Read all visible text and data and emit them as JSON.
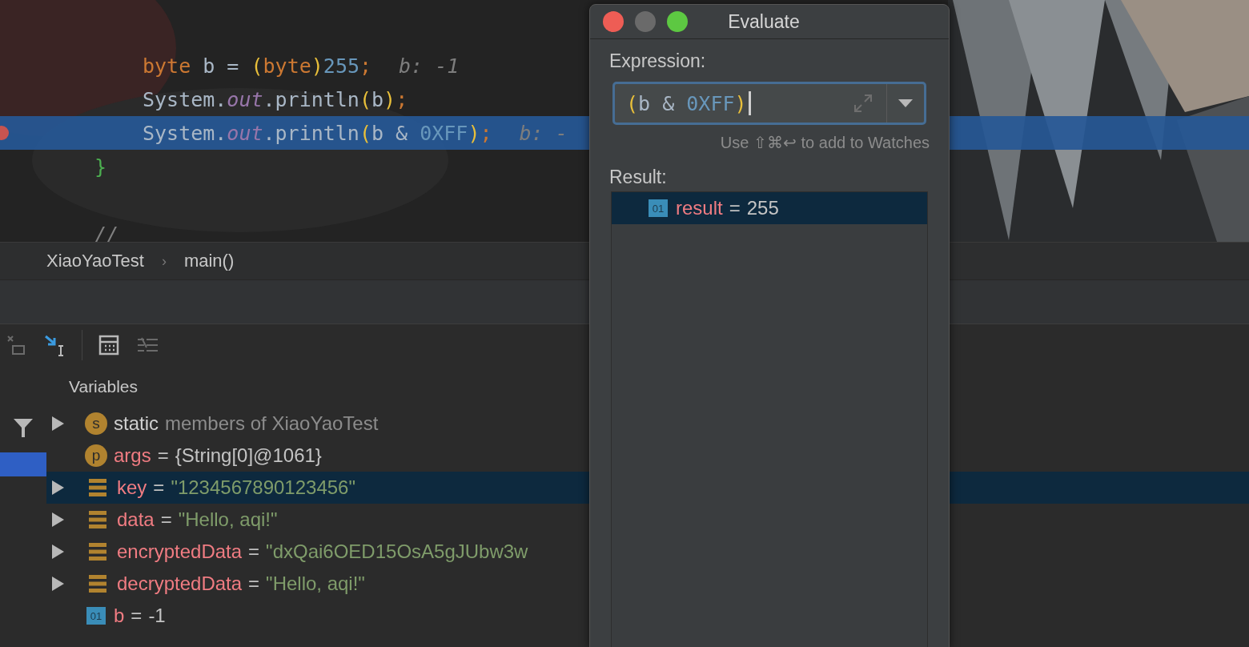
{
  "editor": {
    "lines": [
      {
        "kind": "blank",
        "current": false
      },
      {
        "kind": "blank",
        "current": false
      },
      {
        "kind": "body",
        "current": false,
        "tokens": [
          {
            "text": "byte",
            "kind": "keyword"
          },
          {
            "text": " b = ",
            "kind": "plain"
          },
          {
            "text": "(",
            "kind": "paren"
          },
          {
            "text": "byte",
            "kind": "keyword"
          },
          {
            "text": ")",
            "kind": "paren"
          },
          {
            "text": "255",
            "kind": "number"
          },
          {
            "text": ";",
            "kind": "keyword"
          }
        ],
        "hint": "b: -1"
      },
      {
        "kind": "body",
        "current": false,
        "tokens": [
          {
            "text": "System.",
            "kind": "plain"
          },
          {
            "text": "out",
            "kind": "field"
          },
          {
            "text": ".println",
            "kind": "plain"
          },
          {
            "text": "(",
            "kind": "paren"
          },
          {
            "text": "b",
            "kind": "plain"
          },
          {
            "text": ")",
            "kind": "paren"
          },
          {
            "text": ";",
            "kind": "keyword"
          }
        ]
      },
      {
        "kind": "body",
        "current": true,
        "breakpoint": true,
        "tokens": [
          {
            "text": "System.",
            "kind": "plain"
          },
          {
            "text": "out",
            "kind": "field"
          },
          {
            "text": ".println",
            "kind": "plain"
          },
          {
            "text": "(",
            "kind": "paren"
          },
          {
            "text": "b & ",
            "kind": "plain"
          },
          {
            "text": "0XFF",
            "kind": "number"
          },
          {
            "text": ")",
            "kind": "paren"
          },
          {
            "text": ";",
            "kind": "keyword"
          }
        ],
        "hint": "b: -"
      },
      {
        "kind": "block_end",
        "current": false,
        "tokens": [
          {
            "text": "}",
            "kind": "brace"
          }
        ]
      },
      {
        "kind": "blank",
        "current": false
      },
      {
        "kind": "block_end",
        "current": false,
        "tokens": [
          {
            "text": "//",
            "kind": "comment"
          }
        ]
      }
    ]
  },
  "breadcrumbs": {
    "items": [
      "XiaoYaoTest",
      "main()"
    ],
    "separator": "›"
  },
  "variables": {
    "title": "Variables",
    "rows": [
      {
        "kind": "static",
        "badge": "s",
        "expandable": true,
        "selected": false,
        "name": "static",
        "value": "members of XiaoYaoTest",
        "color": "#8c8c8c"
      },
      {
        "kind": "param",
        "badge": "p",
        "expandable": false,
        "selected": false,
        "name": "args",
        "equals": "=",
        "value": "{String[0]@1061}",
        "color": "#c4c4c4"
      },
      {
        "kind": "field",
        "expandable": true,
        "selected": true,
        "name": "key",
        "equals": "=",
        "value": "\"1234567890123456\"",
        "color": "#7f9c6a"
      },
      {
        "kind": "field",
        "expandable": true,
        "selected": false,
        "name": "data",
        "equals": "=",
        "value": "\"Hello, aqi!\"",
        "color": "#7f9c6a"
      },
      {
        "kind": "field",
        "expandable": true,
        "selected": false,
        "name": "encryptedData",
        "equals": "=",
        "value": "\"dxQai6OED15OsA5gJUbw3w",
        "color": "#7f9c6a"
      },
      {
        "kind": "field",
        "expandable": true,
        "selected": false,
        "name": "decryptedData",
        "equals": "=",
        "value": "\"Hello, aqi!\"",
        "color": "#7f9c6a"
      },
      {
        "kind": "primitive",
        "badge": "01",
        "expandable": false,
        "selected": false,
        "name": "b",
        "equals": "=",
        "value": "-1",
        "color": "#c4c4c4"
      }
    ]
  },
  "dialog": {
    "title": "Evaluate",
    "expression_label": "Expression:",
    "expression": [
      {
        "text": "(",
        "kind": "paren"
      },
      {
        "text": "b & ",
        "kind": "plain"
      },
      {
        "text": "0XFF",
        "kind": "number"
      },
      {
        "text": ")",
        "kind": "paren"
      }
    ],
    "hint": "Use ⇧⌘↩ to add to Watches",
    "result_label": "Result:",
    "results": [
      {
        "badge": "01",
        "name": "result",
        "equals": "=",
        "value": "255",
        "selected": true
      }
    ]
  }
}
